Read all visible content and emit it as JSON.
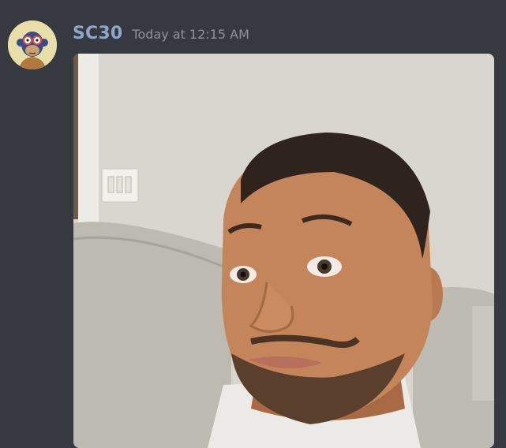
{
  "message": {
    "author": "SC30",
    "timestamp": "Today at 12:15 AM",
    "avatar_icon": "bored-ape-avatar-icon",
    "attachment_icon": "selfie-photo-attachment"
  },
  "colors": {
    "background": "#36393f",
    "username": "#8fa8c9",
    "timestamp": "#8e9297"
  }
}
